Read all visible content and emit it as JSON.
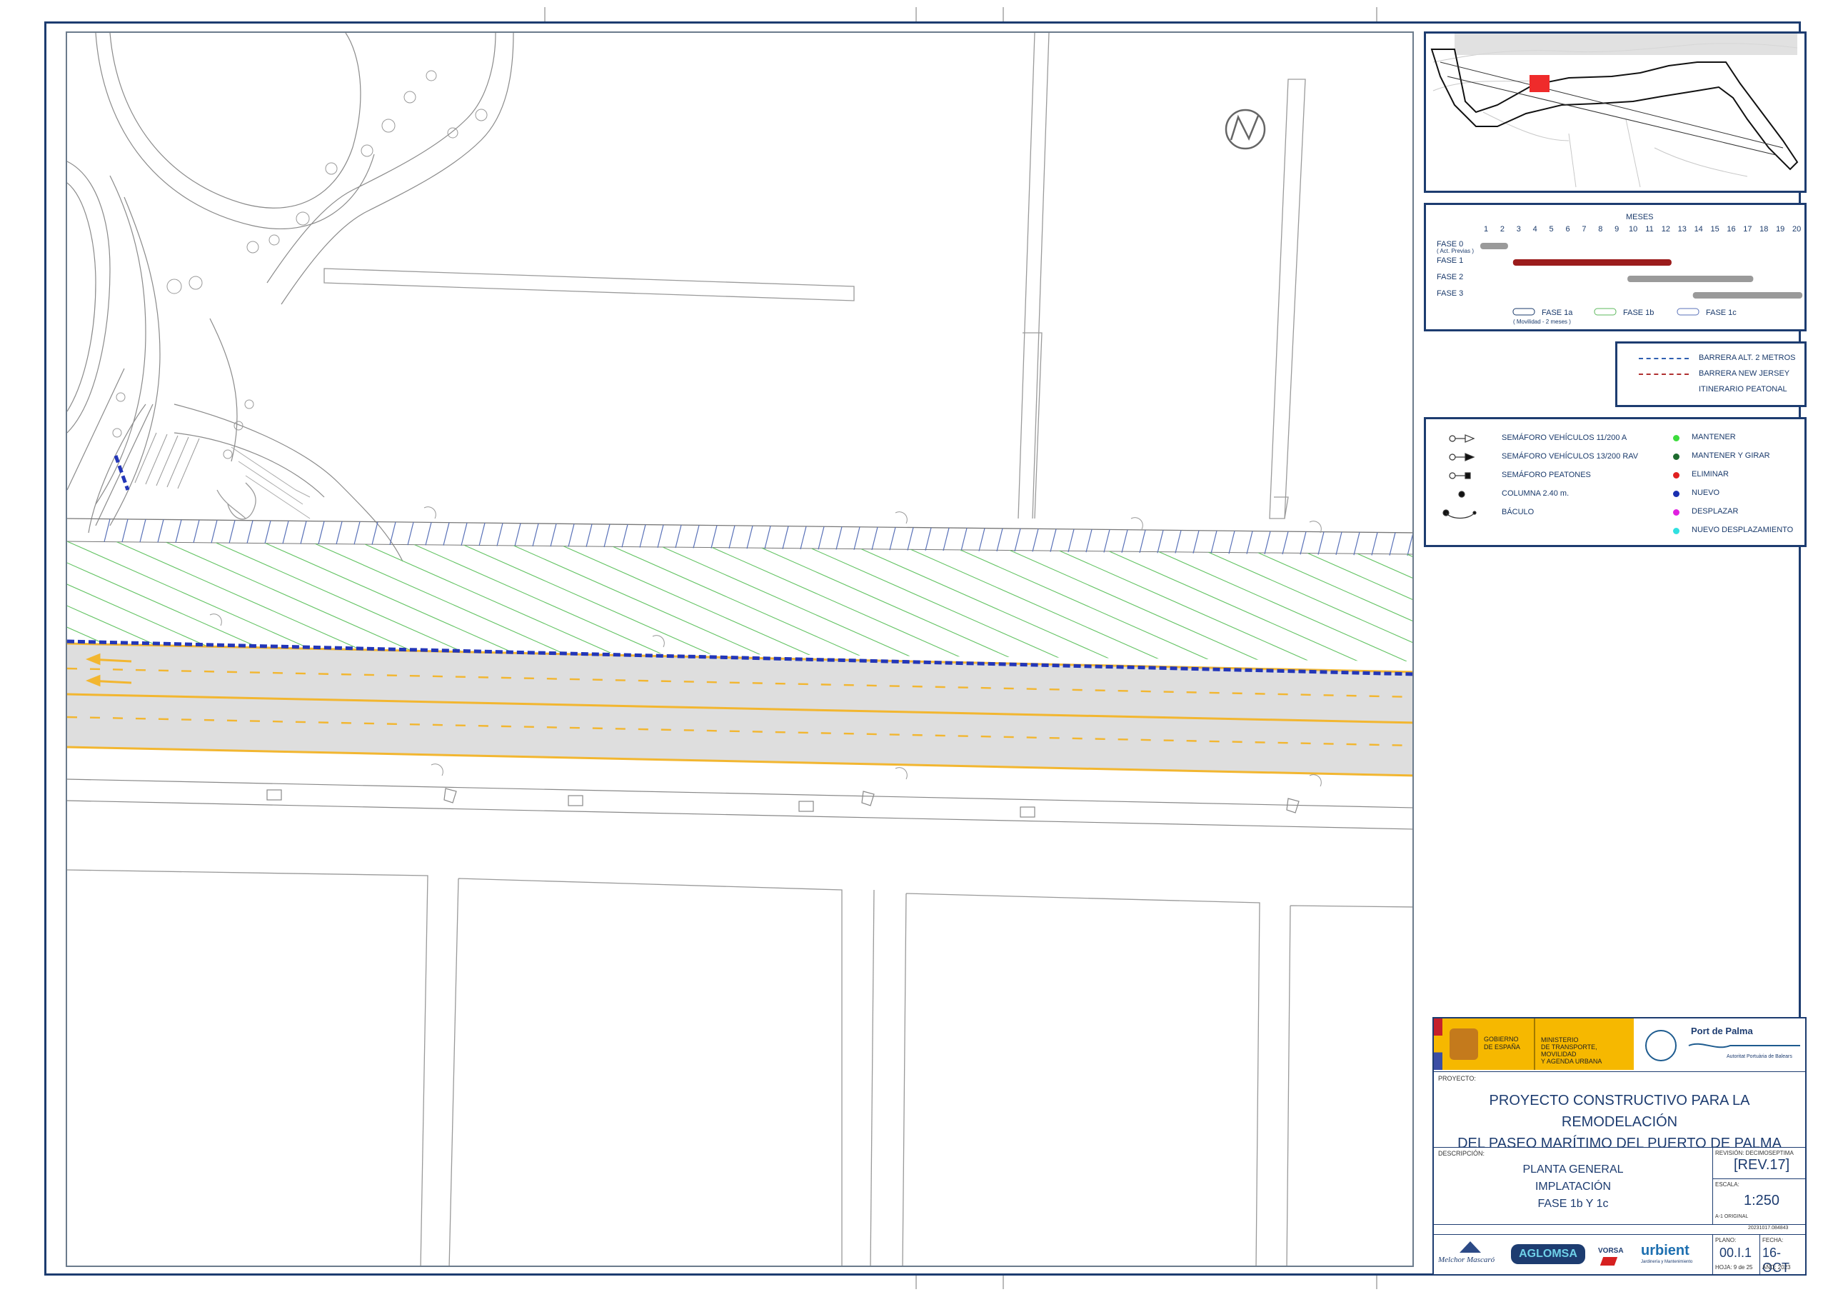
{
  "schedule": {
    "months_title": "MESES",
    "months": [
      "1",
      "2",
      "3",
      "4",
      "5",
      "6",
      "7",
      "8",
      "9",
      "10",
      "11",
      "12",
      "13",
      "14",
      "15",
      "16",
      "17",
      "18",
      "19",
      "20"
    ],
    "phases": [
      {
        "label": "FASE 0",
        "sublabel": "( Act. Previas )",
        "start": 1,
        "end": 2,
        "color": "#9a9a9a"
      },
      {
        "label": "FASE 1",
        "sublabel": "",
        "start": 3,
        "end": 12,
        "color": "#9b1c1c"
      },
      {
        "label": "FASE 2",
        "sublabel": "",
        "start": 10,
        "end": 17,
        "color": "#9a9a9a"
      },
      {
        "label": "FASE 3",
        "sublabel": "",
        "start": 14,
        "end": 20,
        "color": "#9a9a9a"
      }
    ],
    "legend": [
      {
        "label": "FASE 1a",
        "sublabel": "( Movilidad - 2 meses )"
      },
      {
        "label": "FASE 1b",
        "sublabel": ""
      },
      {
        "label": "FASE 1c",
        "sublabel": ""
      }
    ]
  },
  "barriers": {
    "items": [
      {
        "label": "BARRERA ALT. 2 METROS",
        "color": "#2f5fb0"
      },
      {
        "label": "BARRERA NEW JERSEY",
        "color": "#b03030"
      },
      {
        "label": "ITINERARIO PEATONAL",
        "color": ""
      }
    ]
  },
  "symbols": {
    "left": [
      {
        "label": "SEMÁFORO VEHÍCULOS 11/200 A"
      },
      {
        "label": "SEMÁFORO VEHÍCULOS 13/200 RAV"
      },
      {
        "label": "SEMÁFORO PEATONES"
      },
      {
        "label": "COLUMNA 2.40 m."
      },
      {
        "label": "BÁCULO"
      }
    ],
    "right": [
      {
        "label": "MANTENER",
        "color": "#3ddc3d"
      },
      {
        "label": "MANTENER Y GIRAR",
        "color": "#1e6b2e"
      },
      {
        "label": "ELIMINAR",
        "color": "#e02020"
      },
      {
        "label": "NUEVO",
        "color": "#1a2fb0"
      },
      {
        "label": "DESPLAZAR",
        "color": "#e020e0"
      },
      {
        "label": "NUEVO DESPLAZAMIENTO",
        "color": "#30e0e0"
      }
    ]
  },
  "titleblock": {
    "gov1": "GOBIERNO",
    "gov2": "DE ESPAÑA",
    "min1": "MINISTERIO",
    "min2": "DE TRANSPORTE, MOVILIDAD",
    "min3": "Y AGENDA URBANA",
    "port_name": "Port de Palma",
    "port_sub": "Autoritat Portuària de Balears",
    "proyecto_label": "PROYECTO:",
    "project_line1": "PROYECTO CONSTRUCTIVO PARA LA REMODELACIÓN",
    "project_line2": "DEL PASEO MARÍTIMO DEL PUERTO DE PALMA",
    "descripcion_label": "DESCRIPCIÓN:",
    "desc1": "PLANTA GENERAL",
    "desc2": "IMPLATACIÓN",
    "desc3": "FASE 1b Y 1c",
    "revision_label": "REVISIÓN: DECIMOSEPTIMA",
    "revision": "[REV.17]",
    "escala_label": "ESCALA:",
    "escala": "1:250",
    "format": "A-1 ORIGINAL",
    "code": "20231017.084843",
    "plano_label": "PLANO:",
    "plano": "00.I.1",
    "hoja": "HOJA: 9 de 25",
    "fecha_label": "FECHA:",
    "fecha": "16-OCT",
    "anio": "AÑO: 2023",
    "logo1": "Melchor Mascaró",
    "logo2": "AGLOMSA",
    "logo3": "VORSA",
    "logo4": "urbient",
    "logo4_sub": "Jardinería y Mantenimiento"
  }
}
